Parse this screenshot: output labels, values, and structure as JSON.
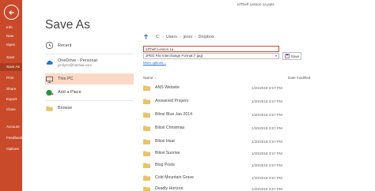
{
  "window": {
    "title": "IdTheft Lesson 1a.pptx"
  },
  "rail": {
    "items": [
      {
        "label": "Info",
        "active": false
      },
      {
        "label": "New",
        "active": false
      },
      {
        "label": "Open",
        "active": false
      },
      {
        "label": "Save",
        "active": false
      },
      {
        "label": "Save As",
        "active": true
      },
      {
        "label": "Print",
        "active": false
      },
      {
        "label": "Share",
        "active": false
      },
      {
        "label": "Export",
        "active": false
      },
      {
        "label": "Close",
        "active": false
      },
      {
        "label": "Account",
        "active": false
      },
      {
        "label": "Feedback",
        "active": false
      },
      {
        "label": "Options",
        "active": false
      }
    ]
  },
  "page": {
    "title": "Save As"
  },
  "locations": [
    {
      "label": "Recent",
      "icon": "clock-icon"
    },
    {
      "label": "OneDrive - Personal",
      "sub": "jenilynn@hotmail.com",
      "icon": "cloud-icon"
    },
    {
      "label": "This PC",
      "icon": "computer-icon",
      "selected": true
    },
    {
      "label": "Add a Place",
      "icon": "globe-plus-icon"
    },
    {
      "label": "Browse",
      "icon": "folder-icon"
    }
  ],
  "breadcrumb": [
    "C:",
    "Users",
    "jenni",
    "Dropbox"
  ],
  "filename": {
    "value": "IdTheft Lesson 1a"
  },
  "filetype": {
    "value": "JPEG File Interchange Format (*.jpg)"
  },
  "save_button": {
    "label": "Save"
  },
  "more_options": {
    "label": "More options..."
  },
  "columns": {
    "name": "Name",
    "date": "Date modified"
  },
  "files": [
    {
      "name": "ANS Website",
      "date": "1/20/2018 3:57 PM"
    },
    {
      "name": "Answered Prayers",
      "date": "1/20/2018 3:57 PM"
    },
    {
      "name": "Biloxi Blue Jan 2014",
      "date": "1/20/2018 3:57 PM"
    },
    {
      "name": "Biloxi Christmas",
      "date": "1/20/2018 3:57 PM"
    },
    {
      "name": "Biloxi Heat",
      "date": "1/20/2018 3:57 PM"
    },
    {
      "name": "Biloxi Sunrise",
      "date": "1/20/2018 3:57 PM"
    },
    {
      "name": "Blog Posts",
      "date": "1/20/2018 3:57 PM"
    },
    {
      "name": "Cold Mountain Grave",
      "date": "1/20/2018 3:57 PM"
    },
    {
      "name": "Deadly Horizon",
      "date": "1/20/2018 3:57 PM"
    }
  ],
  "colors": {
    "accent": "#c9492b",
    "rail_active": "#a83c21",
    "selected_location": "#fbd9c6",
    "folder": "#e8c36b",
    "link": "#2a6fc2",
    "up_arrow": "#2a6fc2"
  }
}
